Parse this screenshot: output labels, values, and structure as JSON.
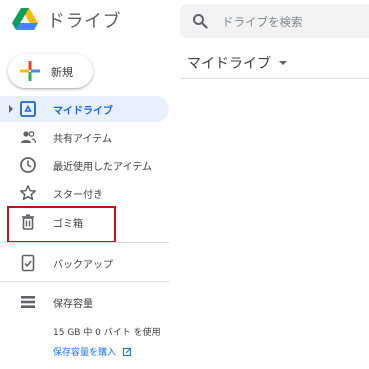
{
  "app": {
    "title": "ドライブ"
  },
  "search": {
    "placeholder": "ドライブを検索"
  },
  "new_button": {
    "label": "新規"
  },
  "sidebar": {
    "items": [
      {
        "label": "マイドライブ",
        "icon": "my-drive-icon",
        "active": true
      },
      {
        "label": "共有アイテム",
        "icon": "shared-people-icon"
      },
      {
        "label": "最近使用したアイテム",
        "icon": "clock-icon"
      },
      {
        "label": "スター付き",
        "icon": "star-icon"
      },
      {
        "label": "ゴミ箱",
        "icon": "trash-icon"
      },
      {
        "label": "バックアップ",
        "icon": "backup-icon"
      },
      {
        "label": "保存容量",
        "icon": "storage-icon"
      }
    ]
  },
  "storage": {
    "usage_text": "15 GB 中 0 バイト を使用",
    "buy_link": "保存容量を購入"
  },
  "main": {
    "title": "マイドライブ"
  },
  "colors": {
    "accent": "#1967d2",
    "active_bg": "#e8f0fe",
    "highlight_border": "#c5121f"
  }
}
